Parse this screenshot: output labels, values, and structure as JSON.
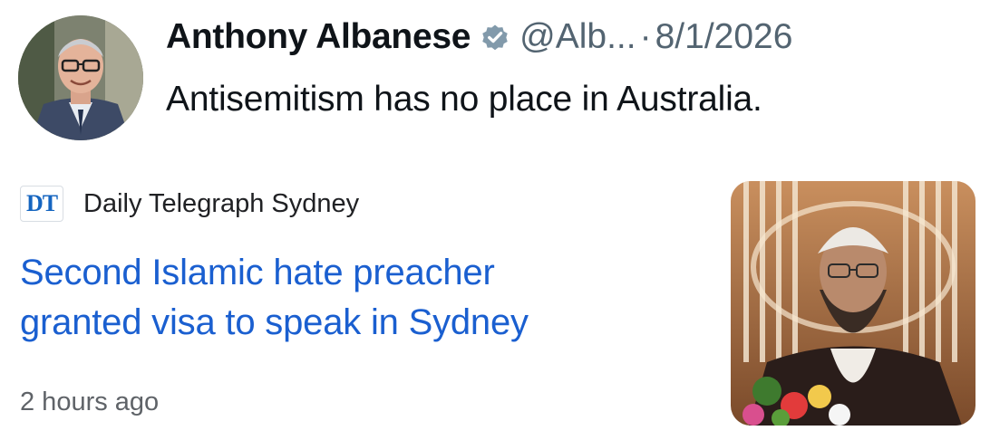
{
  "tweet": {
    "author_name": "Anthony Albanese",
    "handle": "@Alb...",
    "separator": "·",
    "date": "8/1/2026",
    "text": "Antisemitism has no place in Australia.",
    "avatar_icon": "profile-photo",
    "verified_icon": "verified-badge-icon"
  },
  "news_card": {
    "source_logo": "DT",
    "source_name": "Daily Telegraph Sydney",
    "headline_line1": "Second Islamic hate preacher",
    "headline_line2": "granted visa to speak in Sydney",
    "age": "2 hours ago"
  },
  "colors": {
    "headline": "#1a5fd0",
    "source_logo": "#1565c0",
    "muted_text": "#536471",
    "verified_badge": "#829aab"
  }
}
